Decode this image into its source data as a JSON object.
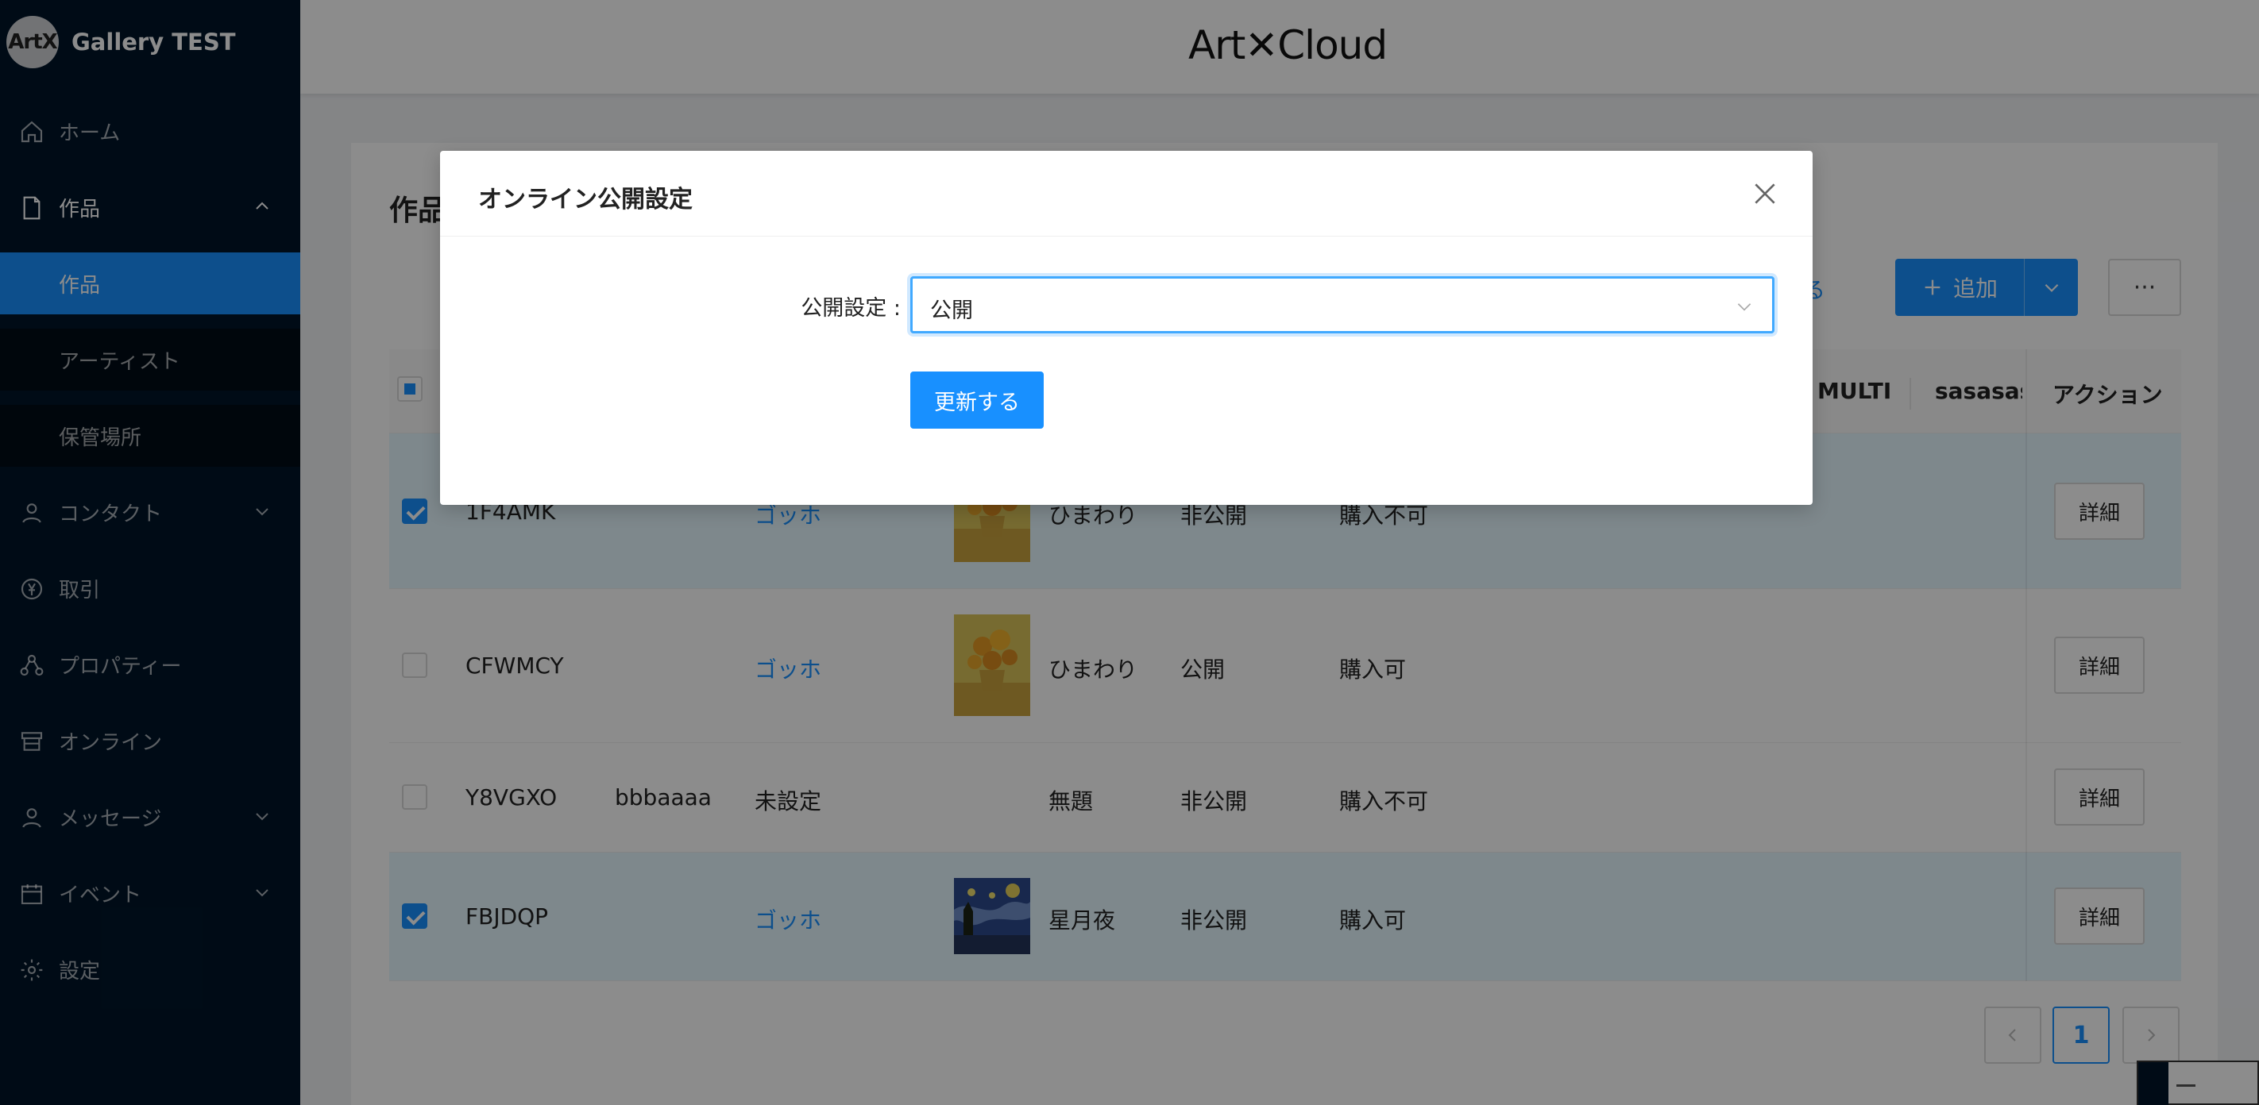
{
  "sidebar": {
    "logo_text": "ArtX",
    "brand": "Gallery TEST",
    "items": [
      {
        "label": "ホーム"
      },
      {
        "label": "作品"
      },
      {
        "label": "作品"
      },
      {
        "label": "アーティスト"
      },
      {
        "label": "保管場所"
      },
      {
        "label": "コンタクト"
      },
      {
        "label": "取引"
      },
      {
        "label": "プロパティー"
      },
      {
        "label": "オンライン"
      },
      {
        "label": "メッセージ"
      },
      {
        "label": "イベント"
      },
      {
        "label": "設定"
      }
    ]
  },
  "header": {
    "logo": "Art✕Cloud"
  },
  "page": {
    "title": "作品",
    "link_partial": "ずする",
    "add_label": "追加",
    "more_label": "···"
  },
  "table": {
    "headers": [
      "MULTI",
      "sasasasa",
      "アクション"
    ],
    "rows": [
      {
        "id": "1F4AMK",
        "col2": "",
        "artist": "ゴッホ",
        "title": "ひまわり",
        "status": "非公開",
        "purchase": "購入不可",
        "action": "詳細"
      },
      {
        "id": "CFWMCY",
        "col2": "",
        "artist": "ゴッホ",
        "title": "ひまわり",
        "status": "公開",
        "purchase": "購入可",
        "action": "詳細"
      },
      {
        "id": "Y8VGXO",
        "col2": "bbbaaaa",
        "artist": "未設定",
        "title": "無題",
        "status": "非公開",
        "purchase": "購入不可",
        "action": "詳細"
      },
      {
        "id": "FBJDQP",
        "col2": "",
        "artist": "ゴッホ",
        "title": "星月夜",
        "status": "非公開",
        "purchase": "購入可",
        "action": "詳細"
      }
    ]
  },
  "pagination": {
    "current": "1"
  },
  "modal": {
    "title": "オンライン公開設定",
    "field_label": "公開設定 :",
    "select_value": "公開",
    "submit_label": "更新する"
  },
  "colors": {
    "sidebar_bg": "#001529",
    "primary": "#1890ff",
    "selected_row": "#e6f7ff"
  }
}
